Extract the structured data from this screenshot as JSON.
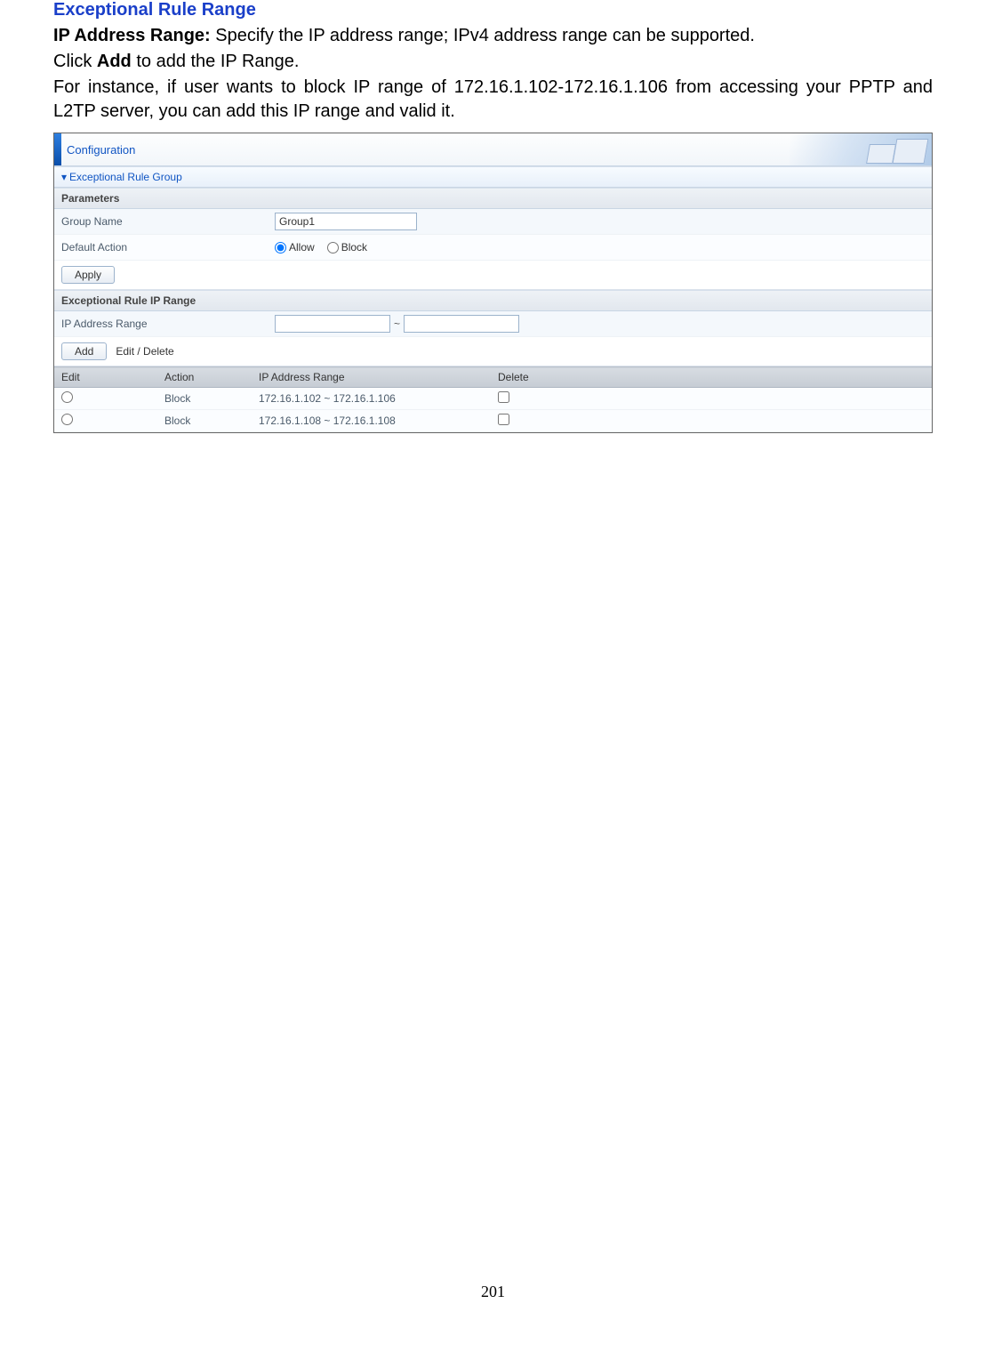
{
  "doc": {
    "heading": "Exceptional Rule Range",
    "para1_prefix_bold": "IP Address Range:",
    "para1_rest": " Specify the IP address range; IPv4 address range can be supported.",
    "para2_pre": "Click ",
    "para2_bold": "Add",
    "para2_post": " to add the IP Range.",
    "para3": "For instance, if user wants to block IP range of 172.16.1.102-172.16.1.106 from accessing your PPTP and L2TP server, you can add this IP range and valid it.",
    "page_number": "201"
  },
  "ui": {
    "config_title": "Configuration",
    "section_group": "Exceptional Rule Group",
    "sub_parameters": "Parameters",
    "label_group_name": "Group Name",
    "value_group_name": "Group1",
    "label_default_action": "Default Action",
    "radio_allow": "Allow",
    "radio_block": "Block",
    "btn_apply": "Apply",
    "sub_ip_range": "Exceptional Rule IP Range",
    "label_ip_range": "IP Address Range",
    "ip_start": "",
    "ip_end": "",
    "tilde": "~",
    "btn_add": "Add",
    "link_edit_delete": "Edit / Delete",
    "table": {
      "headers": {
        "edit": "Edit",
        "action": "Action",
        "range": "IP Address Range",
        "delete": "Delete"
      },
      "rows": [
        {
          "action": "Block",
          "range": "172.16.1.102 ~ 172.16.1.106"
        },
        {
          "action": "Block",
          "range": "172.16.1.108 ~ 172.16.1.108"
        }
      ]
    }
  }
}
